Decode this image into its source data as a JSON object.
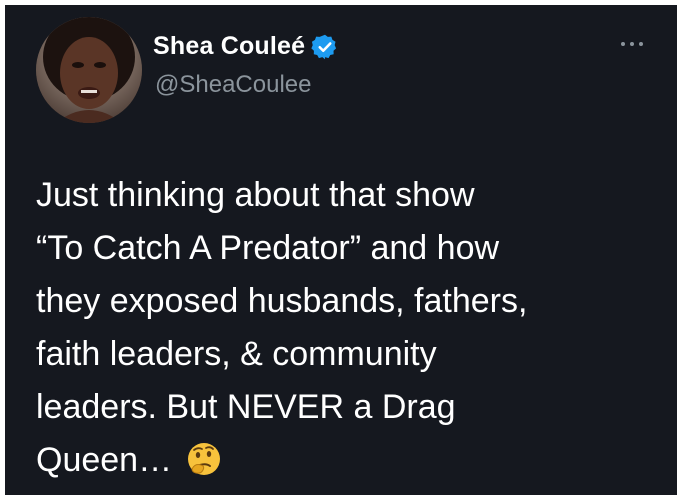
{
  "tweet": {
    "author": {
      "display_name": "Shea Couleé",
      "handle": "@SheaCoulee",
      "verified": true,
      "verified_color": "#1d9bf0"
    },
    "text_lines": [
      "Just thinking about that show",
      "“To Catch A Predator” and how",
      "they exposed husbands, fathers,",
      "faith leaders, & community",
      "leaders. But NEVER a Drag",
      "Queen…"
    ],
    "trailing_emoji": "thinking-face-emoji",
    "more_menu_icon": "more-options-icon"
  },
  "theme": {
    "card_background": "#15181f",
    "text_color": "#ffffff",
    "secondary_text_color": "#8b949c"
  }
}
